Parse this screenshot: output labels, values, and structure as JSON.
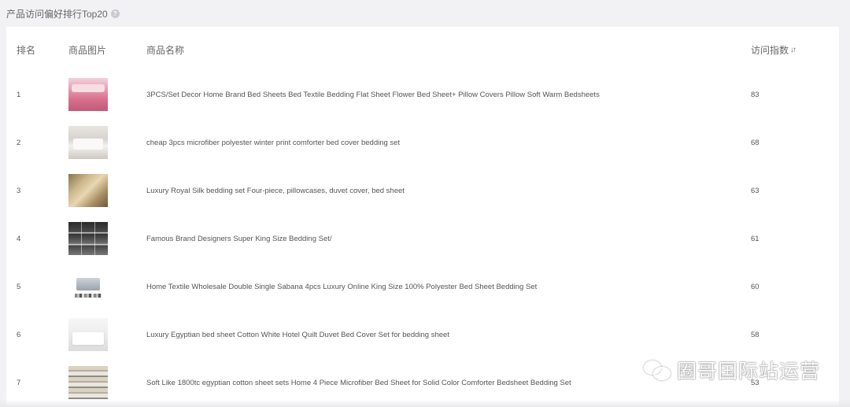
{
  "page": {
    "title": "产品访问偏好排行Top20",
    "help_glyph": "?"
  },
  "table": {
    "headers": {
      "rank": "排名",
      "image": "商品图片",
      "name": "商品名称",
      "index": "访问指数"
    },
    "sort_glyph": "↓↑",
    "rows": [
      {
        "rank": "1",
        "name": "3PCS/Set Decor Home Brand Bed Sheets Bed Textile Bedding Flat Sheet Flower Bed Sheet+ Pillow Covers Pillow Soft Warm Bedsheets",
        "index": "83"
      },
      {
        "rank": "2",
        "name": "cheap 3pcs microfiber polyester winter print comforter bed cover bedding set",
        "index": "68"
      },
      {
        "rank": "3",
        "name": "Luxury Royal Silk bedding set Four-piece, pillowcases, duvet cover, bed sheet",
        "index": "63"
      },
      {
        "rank": "4",
        "name": "Famous Brand Designers Super King Size Bedding Set/",
        "index": "61"
      },
      {
        "rank": "5",
        "name": "Home Textile Wholesale Double Single Sabana 4pcs Luxury Online King Size 100% Polyester Bed Sheet Bedding Set",
        "index": "60"
      },
      {
        "rank": "6",
        "name": "Luxury Egyptian bed sheet Cotton White Hotel Quilt Duvet Bed Cover Set for bedding sheet",
        "index": "58"
      },
      {
        "rank": "7",
        "name": "Soft Like 1800tc egyptian cotton sheet sets Home 4 Piece Microfiber Bed Sheet for Solid Color Comforter Bedsheet Bedding Set",
        "index": "53"
      }
    ]
  },
  "watermark": {
    "text": "圈哥国际站运营"
  }
}
